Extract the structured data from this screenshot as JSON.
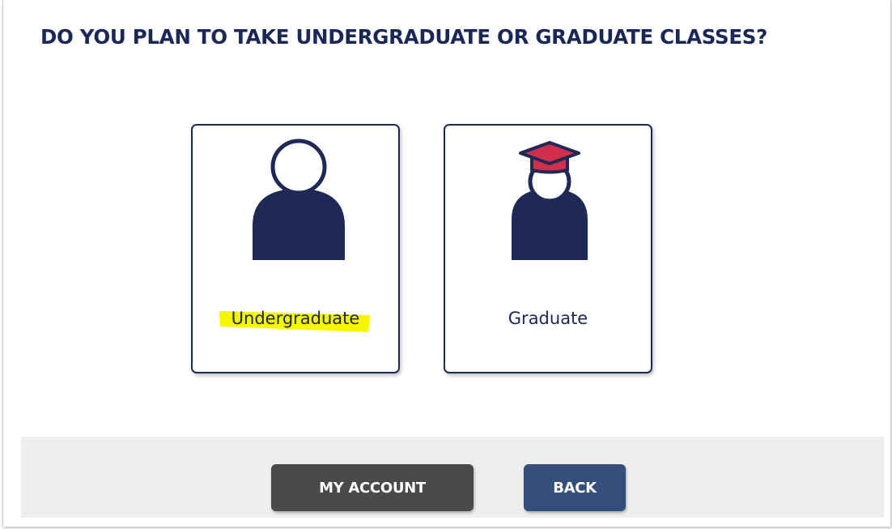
{
  "page": {
    "title": "DO YOU PLAN TO TAKE UNDERGRADUATE OR GRADUATE CLASSES?"
  },
  "choices": [
    {
      "label": "Undergraduate",
      "icon": "person-icon",
      "highlighted": true
    },
    {
      "label": "Graduate",
      "icon": "graduate-person-icon",
      "highlighted": false
    }
  ],
  "footer": {
    "my_account_label": "MY ACCOUNT",
    "back_label": "BACK"
  },
  "colors": {
    "navy": "#1e2a55",
    "cap_red": "#cf2f4b",
    "highlight_yellow": "#f6f600",
    "my_account_button": "#4a4a4a",
    "back_button": "#34507a",
    "footer_background": "#eeeeee"
  }
}
